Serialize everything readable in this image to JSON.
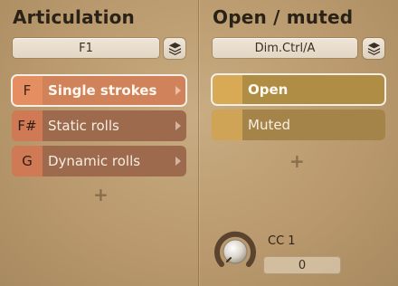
{
  "articulation": {
    "title": "Articulation",
    "bank_selector": "F1",
    "items": [
      {
        "key": "F",
        "label": "Single strokes",
        "selected": true
      },
      {
        "key": "F#",
        "label": "Static rolls",
        "selected": false
      },
      {
        "key": "G",
        "label": "Dynamic rolls",
        "selected": false
      }
    ],
    "add_glyph": "+"
  },
  "group": {
    "title": "Open / muted",
    "controller_selector": "Dim.Ctrl/A",
    "items": [
      {
        "label": "Open",
        "selected": true
      },
      {
        "label": "Muted",
        "selected": false
      }
    ],
    "add_glyph": "+"
  },
  "controller": {
    "label": "CC 1",
    "value": "0",
    "knob_level": 0
  },
  "icons": {
    "layers": "stack-layers-icon",
    "arrow": "chevron-right-icon"
  },
  "colors": {
    "articulation_selected": "#d0825a",
    "articulation_item": "#9e6a4e",
    "group_item": "#a48449",
    "background": "#b8986c"
  }
}
